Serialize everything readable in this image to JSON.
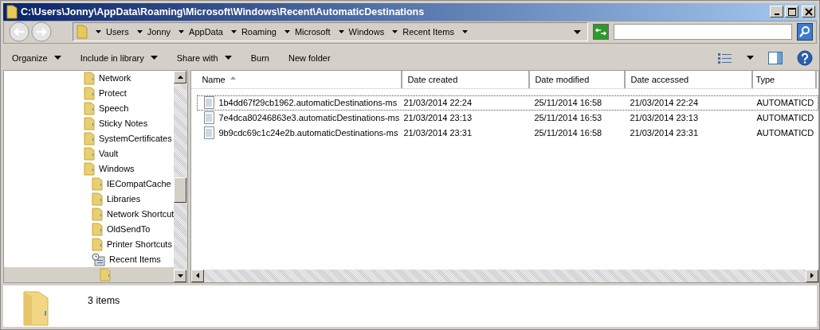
{
  "window": {
    "title": "C:\\Users\\Jonny\\AppData\\Roaming\\Microsoft\\Windows\\Recent\\AutomaticDestinations"
  },
  "address": {
    "crumbs": [
      "Users",
      "Jonny",
      "AppData",
      "Roaming",
      "Microsoft",
      "Windows",
      "Recent Items"
    ]
  },
  "toolbar": [
    {
      "label": "Organize",
      "dropdown": true
    },
    {
      "label": "Include in library",
      "dropdown": true
    },
    {
      "label": "Share with",
      "dropdown": true
    },
    {
      "label": "Burn",
      "dropdown": false
    },
    {
      "label": "New folder",
      "dropdown": false
    }
  ],
  "tree": [
    {
      "label": "Network",
      "kind": "folder",
      "selected": false
    },
    {
      "label": "Protect",
      "kind": "folder",
      "selected": false
    },
    {
      "label": "Speech",
      "kind": "folder",
      "selected": false
    },
    {
      "label": "Sticky Notes",
      "kind": "folder",
      "selected": false
    },
    {
      "label": "SystemCertificates",
      "kind": "folder",
      "selected": false
    },
    {
      "label": "Vault",
      "kind": "folder",
      "selected": false
    },
    {
      "label": "Windows",
      "kind": "folder",
      "selected": false,
      "children": [
        {
          "label": "IECompatCache",
          "kind": "folder",
          "selected": false
        },
        {
          "label": "Libraries",
          "kind": "folder",
          "selected": false
        },
        {
          "label": "Network Shortcut",
          "kind": "folder",
          "selected": false
        },
        {
          "label": "OldSendTo",
          "kind": "folder",
          "selected": false
        },
        {
          "label": "Printer Shortcuts",
          "kind": "folder",
          "selected": false
        },
        {
          "label": "Recent Items",
          "kind": "recent",
          "selected": false,
          "children": [
            {
              "kind": "folder",
              "selected": true
            }
          ]
        }
      ]
    }
  ],
  "table": {
    "columns": [
      {
        "label": "Name",
        "sorted": true
      },
      {
        "label": "Date created",
        "sorted": false
      },
      {
        "label": "Date modified",
        "sorted": false
      },
      {
        "label": "Date accessed",
        "sorted": false
      },
      {
        "label": "Type",
        "sorted": false
      }
    ],
    "rows": [
      {
        "cells": [
          "1b4dd67f29cb1962.automaticDestinations-ms",
          "21/03/2014 22:24",
          "25/11/2014 16:58",
          "21/03/2014 22:24",
          "AUTOMATICD"
        ],
        "focused": true
      },
      {
        "cells": [
          "7e4dca80246863e3.automaticDestinations-ms",
          "21/03/2014 23:13",
          "25/11/2014 16:53",
          "21/03/2014 23:13",
          "AUTOMATICD"
        ],
        "focused": false
      },
      {
        "cells": [
          "9b9cdc69c1c24e2b.automaticDestinations-ms",
          "21/03/2014 23:31",
          "25/11/2014 16:58",
          "21/03/2014 23:31",
          "AUTOMATICD"
        ],
        "focused": false
      }
    ]
  },
  "status_bar": {
    "text": "3 items"
  }
}
